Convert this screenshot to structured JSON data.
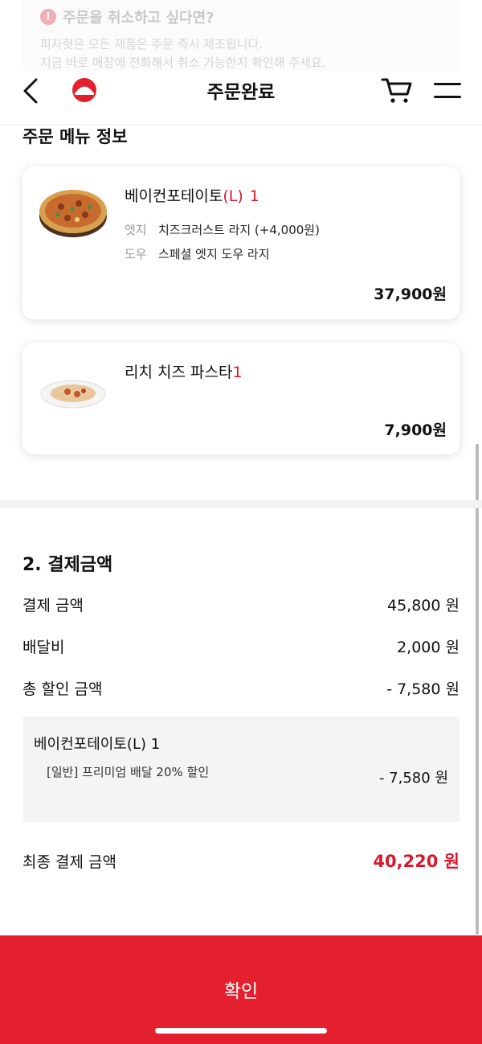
{
  "notice": {
    "title": "주문을 취소하고 싶다면?",
    "line1": "피자헛은 모든 제품은 주문 즉시 제조됩니다.",
    "line2": "지금 바로 매장에 전화해서 취소 가능한지 확인해 주세요."
  },
  "header": {
    "title": "주문완료"
  },
  "menu_section": {
    "title": "주문 메뉴 정보",
    "items": [
      {
        "name": "베이컨포테이토",
        "size": "(L)",
        "qty": "1",
        "options": [
          {
            "label": "엣지",
            "value": "치즈크러스트 라지 (+4,000원)"
          },
          {
            "label": "도우",
            "value": "스페셜 엣지 도우 라지"
          }
        ],
        "price": "37,900원"
      },
      {
        "name": "리치 치즈 파스타",
        "qty": "1",
        "price": "7,900원"
      }
    ]
  },
  "payment": {
    "title": "2. 결제금액",
    "rows": [
      {
        "label": "결제 금액",
        "value": "45,800 원"
      },
      {
        "label": "배달비",
        "value": "2,000 원"
      },
      {
        "label": "총 할인 금액",
        "value": "- 7,580 원"
      }
    ],
    "discount": {
      "item": "베이컨포테이토(L) 1",
      "desc": "[일반] 프리미엄 배달 20% 할인",
      "amount": "- 7,580 원"
    },
    "final": {
      "label": "최종 결제 금액",
      "value": "40,220 원"
    }
  },
  "confirm_label": "확인",
  "colors": {
    "accent": "#e4202f",
    "price_red": "#d6192e"
  }
}
